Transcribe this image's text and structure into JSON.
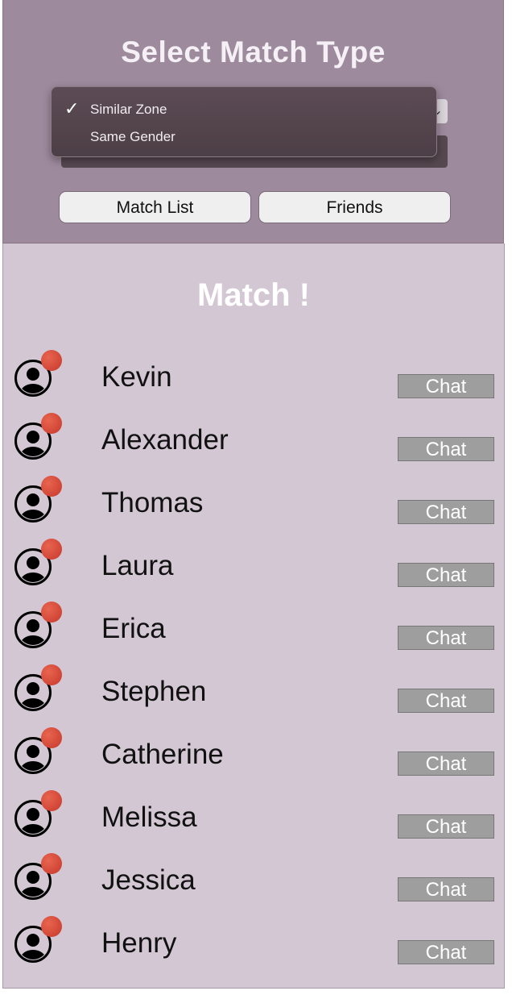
{
  "header": {
    "title": "Select Match Type",
    "dropdown": {
      "options": [
        {
          "label": "Similar Zone",
          "selected": true
        },
        {
          "label": "Same Gender",
          "selected": false
        }
      ]
    },
    "buttons": {
      "match_list": "Match List",
      "friends": "Friends"
    }
  },
  "main": {
    "title": "Match !",
    "chat_label": "Chat",
    "matches": [
      {
        "name": "Kevin"
      },
      {
        "name": "Alexander"
      },
      {
        "name": "Thomas"
      },
      {
        "name": "Laura"
      },
      {
        "name": "Erica"
      },
      {
        "name": "Stephen"
      },
      {
        "name": "Catherine"
      },
      {
        "name": "Melissa"
      },
      {
        "name": "Jessica"
      },
      {
        "name": "Henry"
      }
    ]
  },
  "colors": {
    "header_bg": "#9d8a9d",
    "list_bg": "#d2c7d3",
    "badge": "#d9463a",
    "chat_button": "#9e9e9e"
  },
  "icons": {
    "avatar": "user-circle-icon",
    "badge": "notification-dot-icon",
    "selected": "checkmark-icon"
  }
}
